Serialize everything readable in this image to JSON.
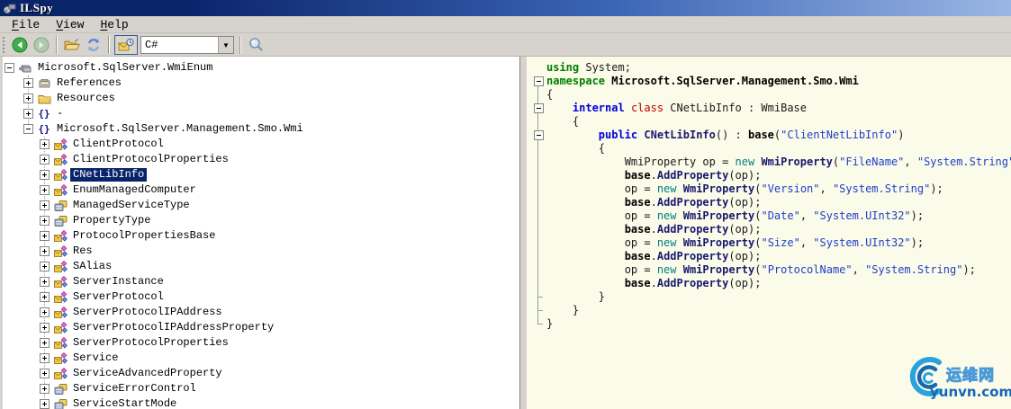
{
  "window": {
    "title": "ILSpy"
  },
  "colors": {
    "titlebar_left": "#0a246a",
    "titlebar_right": "#9ab6e4",
    "chrome_bg": "#d6d3ce",
    "selection_bg": "#0a246a",
    "code_bg": "#fbfbe9",
    "keyword_green": "#008000",
    "keyword_blue": "#0000e0",
    "keyword_red": "#c00000",
    "keyword_teal": "#008080",
    "method_call_blue": "#191970",
    "string_blue": "#2040c8",
    "watermark_blue": "#1565b8"
  },
  "menubar": {
    "items": [
      {
        "label": "File"
      },
      {
        "label": "View"
      },
      {
        "label": "Help"
      }
    ]
  },
  "toolbar": {
    "buttons": [
      {
        "name": "back-button",
        "icon": "back-icon",
        "enabled": true
      },
      {
        "name": "forward-button",
        "icon": "forward-icon",
        "enabled": false
      },
      {
        "name": "open-button",
        "icon": "open-folder-icon",
        "enabled": true
      },
      {
        "name": "refresh-button",
        "icon": "refresh-icon",
        "enabled": true
      },
      {
        "name": "show-internal-toggle",
        "icon": "internal-members-icon",
        "pressed": true
      },
      {
        "name": "search-button",
        "icon": "search-icon",
        "enabled": true
      }
    ],
    "language_combo": {
      "value": "C#"
    }
  },
  "tree": {
    "nodes": [
      {
        "label": "Microsoft.SqlServer.WmiEnum",
        "level": 0,
        "icon": "assembly",
        "expander": "minus",
        "selected": false
      },
      {
        "label": "References",
        "level": 1,
        "icon": "references",
        "expander": "plus",
        "selected": false
      },
      {
        "label": "Resources",
        "level": 1,
        "icon": "folder",
        "expander": "plus",
        "selected": false
      },
      {
        "label": "-",
        "level": 1,
        "icon": "namespace",
        "expander": "plus",
        "selected": false
      },
      {
        "label": "Microsoft.SqlServer.Management.Smo.Wmi",
        "level": 1,
        "icon": "namespace",
        "expander": "minus",
        "selected": false
      },
      {
        "label": "ClientProtocol",
        "level": 2,
        "icon": "class",
        "expander": "plus",
        "selected": false
      },
      {
        "label": "ClientProtocolProperties",
        "level": 2,
        "icon": "class",
        "expander": "plus",
        "selected": false
      },
      {
        "label": "CNetLibInfo",
        "level": 2,
        "icon": "class",
        "expander": "plus",
        "selected": true
      },
      {
        "label": "EnumManagedComputer",
        "level": 2,
        "icon": "class",
        "expander": "plus",
        "selected": false
      },
      {
        "label": "ManagedServiceType",
        "level": 2,
        "icon": "enum",
        "expander": "plus",
        "selected": false
      },
      {
        "label": "PropertyType",
        "level": 2,
        "icon": "enum",
        "expander": "plus",
        "selected": false
      },
      {
        "label": "ProtocolPropertiesBase",
        "level": 2,
        "icon": "class",
        "expander": "plus",
        "selected": false
      },
      {
        "label": "Res",
        "level": 2,
        "icon": "class",
        "expander": "plus",
        "selected": false
      },
      {
        "label": "SAlias",
        "level": 2,
        "icon": "class",
        "expander": "plus",
        "selected": false
      },
      {
        "label": "ServerInstance",
        "level": 2,
        "icon": "class",
        "expander": "plus",
        "selected": false
      },
      {
        "label": "ServerProtocol",
        "level": 2,
        "icon": "class",
        "expander": "plus",
        "selected": false
      },
      {
        "label": "ServerProtocolIPAddress",
        "level": 2,
        "icon": "class",
        "expander": "plus",
        "selected": false
      },
      {
        "label": "ServerProtocolIPAddressProperty",
        "level": 2,
        "icon": "class",
        "expander": "plus",
        "selected": false
      },
      {
        "label": "ServerProtocolProperties",
        "level": 2,
        "icon": "class",
        "expander": "plus",
        "selected": false
      },
      {
        "label": "Service",
        "level": 2,
        "icon": "class",
        "expander": "plus",
        "selected": false
      },
      {
        "label": "ServiceAdvancedProperty",
        "level": 2,
        "icon": "class",
        "expander": "plus",
        "selected": false
      },
      {
        "label": "ServiceErrorControl",
        "level": 2,
        "icon": "enum",
        "expander": "plus",
        "selected": false
      },
      {
        "label": "ServiceStartMode",
        "level": 2,
        "icon": "enum",
        "expander": "plus",
        "selected": false
      }
    ]
  },
  "code": {
    "lines": [
      {
        "fold": "",
        "tokens": [
          [
            "g",
            "using"
          ],
          [
            "p",
            " System;"
          ]
        ]
      },
      {
        "fold": "box0",
        "tokens": [
          [
            "g",
            "namespace"
          ],
          [
            "nb",
            " Microsoft.SqlServer.Management.Smo.Wmi"
          ]
        ]
      },
      {
        "fold": "v",
        "tokens": [
          [
            "p",
            "{"
          ]
        ]
      },
      {
        "fold": "box",
        "tokens": [
          [
            "p",
            "    "
          ],
          [
            "b",
            "internal"
          ],
          [
            "p",
            " "
          ],
          [
            "r",
            "class"
          ],
          [
            "p",
            " CNetLibInfo : WmiBase"
          ]
        ]
      },
      {
        "fold": "v",
        "tokens": [
          [
            "p",
            "    {"
          ]
        ]
      },
      {
        "fold": "box",
        "tokens": [
          [
            "p",
            "        "
          ],
          [
            "b",
            "public"
          ],
          [
            "p",
            " "
          ],
          [
            "m",
            "CNetLibInfo"
          ],
          [
            "p",
            "() : "
          ],
          [
            "k",
            "base"
          ],
          [
            "p",
            "("
          ],
          [
            "s",
            "\"ClientNetLibInfo\""
          ],
          [
            "p",
            ")"
          ]
        ]
      },
      {
        "fold": "v",
        "tokens": [
          [
            "p",
            "        {"
          ]
        ]
      },
      {
        "fold": "v",
        "tokens": [
          [
            "p",
            "            WmiProperty op = "
          ],
          [
            "t",
            "new"
          ],
          [
            "p",
            " "
          ],
          [
            "m",
            "WmiProperty"
          ],
          [
            "p",
            "("
          ],
          [
            "s",
            "\"FileName\""
          ],
          [
            "p",
            ", "
          ],
          [
            "s",
            "\"System.String\""
          ],
          [
            "p",
            ");"
          ]
        ]
      },
      {
        "fold": "v",
        "tokens": [
          [
            "p",
            "            "
          ],
          [
            "k",
            "base"
          ],
          [
            "p",
            "."
          ],
          [
            "m",
            "AddProperty"
          ],
          [
            "p",
            "(op);"
          ]
        ]
      },
      {
        "fold": "v",
        "tokens": [
          [
            "p",
            "            op = "
          ],
          [
            "t",
            "new"
          ],
          [
            "p",
            " "
          ],
          [
            "m",
            "WmiProperty"
          ],
          [
            "p",
            "("
          ],
          [
            "s",
            "\"Version\""
          ],
          [
            "p",
            ", "
          ],
          [
            "s",
            "\"System.String\""
          ],
          [
            "p",
            ");"
          ]
        ]
      },
      {
        "fold": "v",
        "tokens": [
          [
            "p",
            "            "
          ],
          [
            "k",
            "base"
          ],
          [
            "p",
            "."
          ],
          [
            "m",
            "AddProperty"
          ],
          [
            "p",
            "(op);"
          ]
        ]
      },
      {
        "fold": "v",
        "tokens": [
          [
            "p",
            "            op = "
          ],
          [
            "t",
            "new"
          ],
          [
            "p",
            " "
          ],
          [
            "m",
            "WmiProperty"
          ],
          [
            "p",
            "("
          ],
          [
            "s",
            "\"Date\""
          ],
          [
            "p",
            ", "
          ],
          [
            "s",
            "\"System.UInt32\""
          ],
          [
            "p",
            ");"
          ]
        ]
      },
      {
        "fold": "v",
        "tokens": [
          [
            "p",
            "            "
          ],
          [
            "k",
            "base"
          ],
          [
            "p",
            "."
          ],
          [
            "m",
            "AddProperty"
          ],
          [
            "p",
            "(op);"
          ]
        ]
      },
      {
        "fold": "v",
        "tokens": [
          [
            "p",
            "            op = "
          ],
          [
            "t",
            "new"
          ],
          [
            "p",
            " "
          ],
          [
            "m",
            "WmiProperty"
          ],
          [
            "p",
            "("
          ],
          [
            "s",
            "\"Size\""
          ],
          [
            "p",
            ", "
          ],
          [
            "s",
            "\"System.UInt32\""
          ],
          [
            "p",
            ");"
          ]
        ]
      },
      {
        "fold": "v",
        "tokens": [
          [
            "p",
            "            "
          ],
          [
            "k",
            "base"
          ],
          [
            "p",
            "."
          ],
          [
            "m",
            "AddProperty"
          ],
          [
            "p",
            "(op);"
          ]
        ]
      },
      {
        "fold": "v",
        "tokens": [
          [
            "p",
            "            op = "
          ],
          [
            "t",
            "new"
          ],
          [
            "p",
            " "
          ],
          [
            "m",
            "WmiProperty"
          ],
          [
            "p",
            "("
          ],
          [
            "s",
            "\"ProtocolName\""
          ],
          [
            "p",
            ", "
          ],
          [
            "s",
            "\"System.String\""
          ],
          [
            "p",
            ");"
          ]
        ]
      },
      {
        "fold": "v",
        "tokens": [
          [
            "p",
            "            "
          ],
          [
            "k",
            "base"
          ],
          [
            "p",
            "."
          ],
          [
            "m",
            "AddProperty"
          ],
          [
            "p",
            "(op);"
          ]
        ]
      },
      {
        "fold": "t",
        "tokens": [
          [
            "p",
            "        }"
          ]
        ]
      },
      {
        "fold": "t",
        "tokens": [
          [
            "p",
            "    }"
          ]
        ]
      },
      {
        "fold": "e",
        "tokens": [
          [
            "p",
            "}"
          ]
        ]
      }
    ]
  },
  "watermark": {
    "site_name": "运维网",
    "site_url": "yunvn.com"
  }
}
